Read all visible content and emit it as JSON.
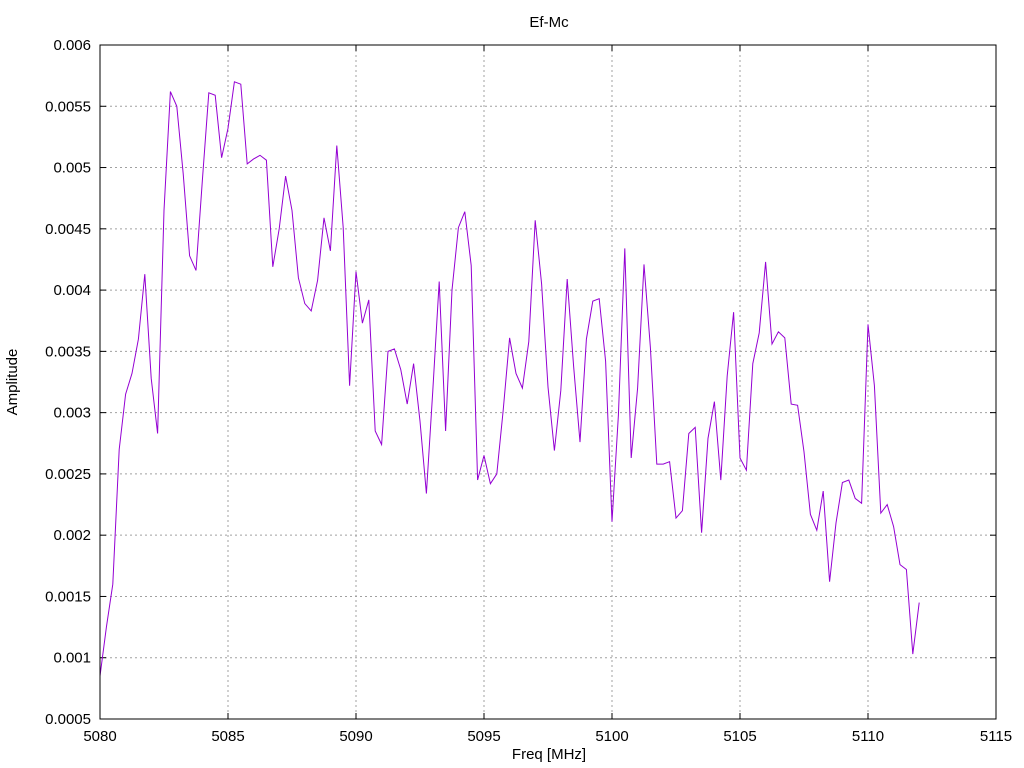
{
  "chart_data": {
    "type": "line",
    "title": "Ef-Mc",
    "xlabel": "Freq [MHz]",
    "ylabel": "Amplitude",
    "xlim": [
      5080,
      5115
    ],
    "ylim": [
      0.0005,
      0.006
    ],
    "grid": true,
    "x_ticks": [
      "5080",
      "5085",
      "5090",
      "5095",
      "5100",
      "5105",
      "5110",
      "5115"
    ],
    "y_ticks": [
      "0.0005",
      "0.001",
      "0.0015",
      "0.002",
      "0.0025",
      "0.003",
      "0.0035",
      "0.004",
      "0.0045",
      "0.005",
      "0.0055",
      "0.006"
    ],
    "series": [
      {
        "color": "#9400d3",
        "x": [
          5080.0,
          5080.25,
          5080.5,
          5080.75,
          5081.0,
          5081.25,
          5081.5,
          5081.75,
          5082.0,
          5082.25,
          5082.5,
          5082.75,
          5083.0,
          5083.25,
          5083.5,
          5083.75,
          5084.0,
          5084.25,
          5084.5,
          5084.75,
          5085.0,
          5085.25,
          5085.5,
          5085.75,
          5086.0,
          5086.25,
          5086.5,
          5086.75,
          5087.0,
          5087.25,
          5087.5,
          5087.75,
          5088.0,
          5088.25,
          5088.5,
          5088.75,
          5089.0,
          5089.25,
          5089.5,
          5089.75,
          5090.0,
          5090.25,
          5090.5,
          5090.75,
          5091.0,
          5091.25,
          5091.5,
          5091.75,
          5092.0,
          5092.25,
          5092.5,
          5092.75,
          5093.0,
          5093.25,
          5093.5,
          5093.75,
          5094.0,
          5094.25,
          5094.5,
          5094.75,
          5095.0,
          5095.25,
          5095.5,
          5095.75,
          5096.0,
          5096.25,
          5096.5,
          5096.75,
          5097.0,
          5097.25,
          5097.5,
          5097.75,
          5098.0,
          5098.25,
          5098.5,
          5098.75,
          5099.0,
          5099.25,
          5099.5,
          5099.75,
          5100.0,
          5100.25,
          5100.5,
          5100.75,
          5101.0,
          5101.25,
          5101.5,
          5101.75,
          5102.0,
          5102.25,
          5102.5,
          5102.75,
          5103.0,
          5103.25,
          5103.5,
          5103.75,
          5104.0,
          5104.25,
          5104.5,
          5104.75,
          5105.0,
          5105.25,
          5105.5,
          5105.75,
          5106.0,
          5106.25,
          5106.5,
          5106.75,
          5107.0,
          5107.25,
          5107.5,
          5107.75,
          5108.0,
          5108.25,
          5108.5,
          5108.75,
          5109.0,
          5109.25,
          5109.5,
          5109.75,
          5110.0,
          5110.25,
          5110.5,
          5110.75,
          5111.0,
          5111.25,
          5111.5,
          5111.75,
          5112.0
        ],
        "y": [
          0.00085,
          0.00125,
          0.0016,
          0.0027,
          0.00315,
          0.00332,
          0.0036,
          0.00413,
          0.00328,
          0.00283,
          0.00465,
          0.00562,
          0.0055,
          0.00495,
          0.00428,
          0.00416,
          0.0049,
          0.00561,
          0.00559,
          0.00508,
          0.00532,
          0.0057,
          0.00568,
          0.00503,
          0.00507,
          0.0051,
          0.00506,
          0.00419,
          0.0045,
          0.00493,
          0.00465,
          0.0041,
          0.00389,
          0.00383,
          0.00408,
          0.00459,
          0.00432,
          0.00518,
          0.00451,
          0.00322,
          0.00415,
          0.00373,
          0.00392,
          0.00285,
          0.00274,
          0.0035,
          0.00352,
          0.00335,
          0.00307,
          0.0034,
          0.00293,
          0.00234,
          0.00318,
          0.00407,
          0.00285,
          0.004,
          0.00451,
          0.00464,
          0.0042,
          0.00245,
          0.00265,
          0.00242,
          0.0025,
          0.00302,
          0.00361,
          0.00332,
          0.0032,
          0.00358,
          0.00457,
          0.00405,
          0.00321,
          0.00269,
          0.00318,
          0.00409,
          0.00338,
          0.00276,
          0.0036,
          0.00391,
          0.00393,
          0.00342,
          0.00211,
          0.00298,
          0.00434,
          0.00263,
          0.0032,
          0.00421,
          0.00353,
          0.00258,
          0.00258,
          0.0026,
          0.00214,
          0.0022,
          0.00283,
          0.00288,
          0.00202,
          0.00279,
          0.00309,
          0.00245,
          0.0033,
          0.00382,
          0.00263,
          0.00253,
          0.0034,
          0.00365,
          0.00423,
          0.00356,
          0.00366,
          0.00361,
          0.00307,
          0.00306,
          0.00268,
          0.00217,
          0.00204,
          0.00236,
          0.00162,
          0.0021,
          0.00243,
          0.00245,
          0.0023,
          0.00226,
          0.00372,
          0.00322,
          0.00218,
          0.00225,
          0.00207,
          0.00176,
          0.00172,
          0.00103,
          0.00145
        ]
      }
    ]
  }
}
